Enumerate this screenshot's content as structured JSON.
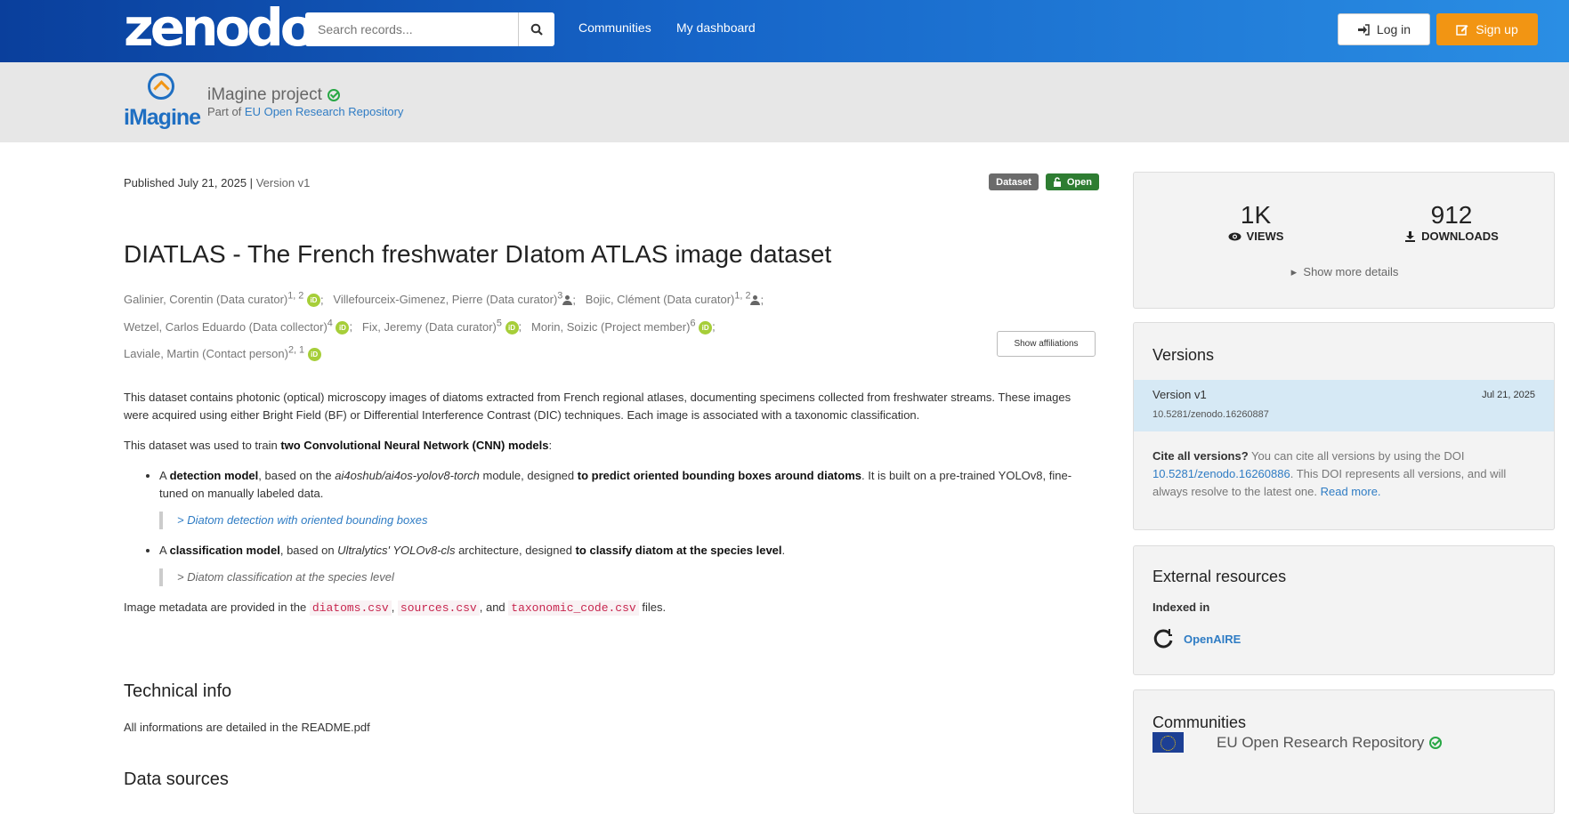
{
  "header": {
    "logo": "zenodo",
    "search_placeholder": "Search records...",
    "nav": [
      "Communities",
      "My dashboard"
    ],
    "login_label": "Log in",
    "signup_label": "Sign up"
  },
  "community": {
    "logo_text": "iMagine",
    "title": "iMagine project",
    "part_of_prefix": "Part of",
    "part_of_link": "EU Open Research Repository"
  },
  "record": {
    "published": "Published July 21, 2025",
    "separator": "|",
    "version": "Version v1",
    "badges": [
      "Dataset",
      "Open"
    ],
    "title": "DIATLAS - The French freshwater DIatom ATLAS image dataset",
    "authors": [
      {
        "name": "Galinier, Corentin (Data curator)",
        "sup": "1, 2",
        "orcid": true,
        "person": false
      },
      {
        "name": "Villefourceix-Gimenez, Pierre (Data curator)",
        "sup": "3",
        "orcid": false,
        "person": true
      },
      {
        "name": "Bojic, Clément (Data curator)",
        "sup": "1, 2",
        "orcid": false,
        "person": true
      },
      {
        "name": "Wetzel, Carlos Eduardo (Data collector)",
        "sup": "4",
        "orcid": true,
        "person": false
      },
      {
        "name": "Fix, Jeremy (Data curator)",
        "sup": "5",
        "orcid": true,
        "person": false
      },
      {
        "name": "Morin, Soizic (Project member)",
        "sup": "6",
        "orcid": true,
        "person": false
      },
      {
        "name": "Laviale, Martin (Contact person)",
        "sup": "2, 1",
        "orcid": true,
        "person": false
      }
    ],
    "show_affiliations": "Show affiliations",
    "desc_p1": "This dataset contains photonic (optical) microscopy images of diatoms extracted from French regional atlases, documenting specimens collected from freshwater streams. These images were acquired using either Bright Field (BF) or Differential Interference Contrast (DIC) techniques. Each image is associated with a taxonomic classification.",
    "desc_p2_a": "This dataset was used to train ",
    "desc_p2_b": "two Convolutional Neural Network (CNN) models",
    "desc_p2_c": ":",
    "li1_a": "A ",
    "li1_b": "detection model",
    "li1_c": ", based on the ",
    "li1_d": "ai4oshub/ai4os-yolov8-torch",
    "li1_e": " module, designed ",
    "li1_f": "to predict oriented bounding boxes around diatoms",
    "li1_g": ". It is built on a pre-trained YOLOv8, fine-tuned on manually labeled data.",
    "li1_quote": "> Diatom detection with oriented bounding boxes",
    "li2_a": "A ",
    "li2_b": "classification model",
    "li2_c": ", based on ",
    "li2_d": "Ultralytics' YOLOv8-cls",
    "li2_e": " architecture, designed ",
    "li2_f": "to classify diatom at the species level",
    "li2_g": ".",
    "li2_quote": "> Diatom classification at the species level",
    "meta_a": "Image metadata are provided in the ",
    "meta_f1": "diatoms.csv",
    "meta_b": ", ",
    "meta_f2": "sources.csv",
    "meta_c": ", and ",
    "meta_f3": "taxonomic_code.csv",
    "meta_d": " files.",
    "tech_heading": "Technical info",
    "tech_text": "All informations are detailed in the README.pdf",
    "sources_heading": "Data sources"
  },
  "sidebar": {
    "views_num": "1K",
    "views_label": "VIEWS",
    "downloads_num": "912",
    "downloads_label": "DOWNLOADS",
    "more_details": "Show more details",
    "versions_heading": "Versions",
    "version_name": "Version v1",
    "version_date": "Jul 21, 2025",
    "version_doi": "10.5281/zenodo.16260887",
    "cite_bold": "Cite all versions?",
    "cite_text1": " You can cite all versions by using the DOI ",
    "cite_doi": "10.5281/zenodo.16260886",
    "cite_text2": ". This DOI represents all versions, and will always resolve to the latest one. ",
    "cite_more": "Read more.",
    "ext_heading": "External resources",
    "indexed_in": "Indexed in",
    "openaire": "OpenAIRE",
    "communities_heading": "Communities",
    "community_name": "EU Open Research Repository"
  },
  "colors": {
    "header_start": "#0a3f9c",
    "header_end": "#2a8ee4",
    "signup": "#f29513",
    "open_badge": "#2e7d32",
    "dataset_badge": "#6b6b6b",
    "link": "#2f7cc4",
    "orcid": "#a6ce39"
  }
}
